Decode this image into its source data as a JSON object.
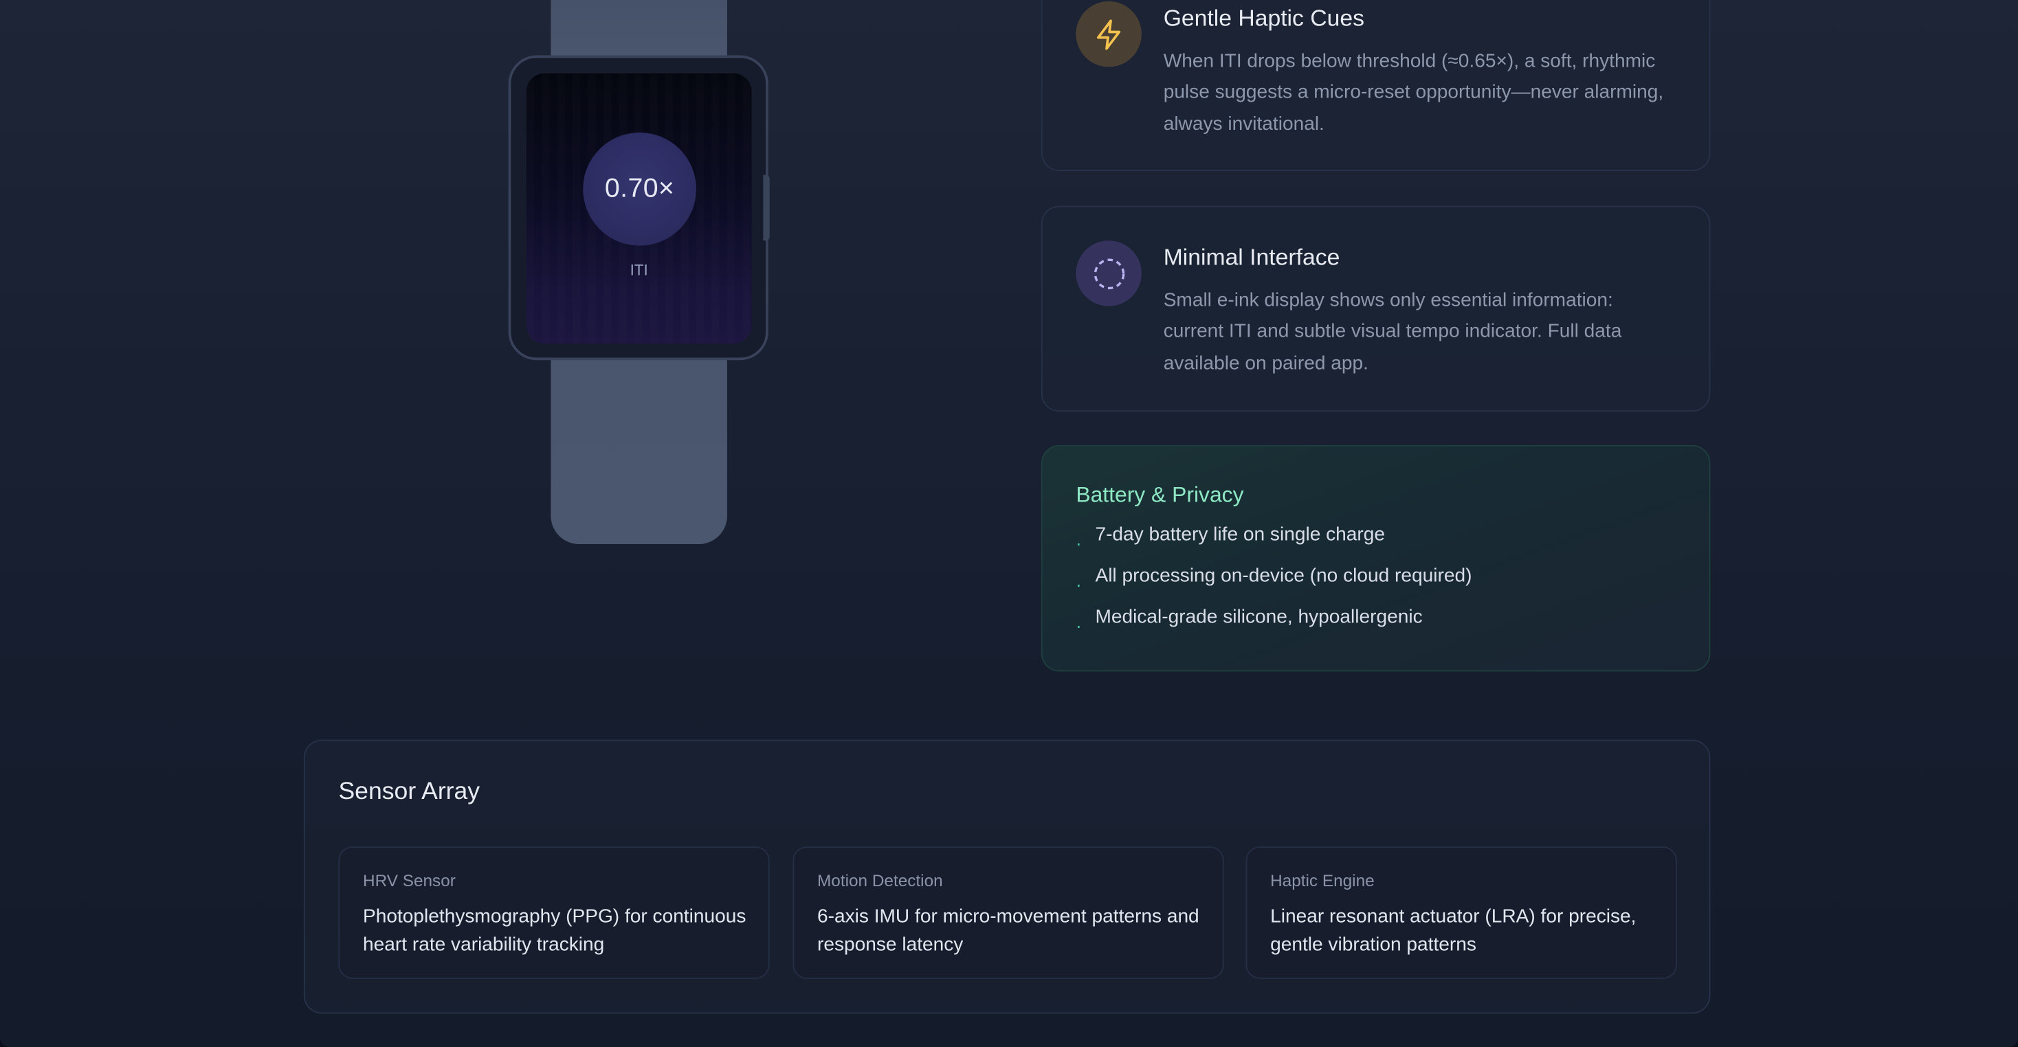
{
  "watch": {
    "iti_value": "0.70×",
    "iti_label": "ITI"
  },
  "features": [
    {
      "icon": "lightning-icon",
      "title": "Gentle Haptic Cues",
      "description": "When ITI drops below threshold (≈0.65×), a soft, rhythmic pulse suggests a micro-reset opportunity—never alarming, always invitational."
    },
    {
      "icon": "dashed-circle-icon",
      "title": "Minimal Interface",
      "description": "Small e-ink display shows only essential information: current ITI and subtle visual tempo indicator. Full data available on paired app."
    }
  ],
  "battery_privacy": {
    "title": "Battery & Privacy",
    "items": [
      "7-day battery life on single charge",
      "All processing on-device (no cloud required)",
      "Medical-grade silicone, hypoallergenic"
    ]
  },
  "sensor_array": {
    "title": "Sensor Array",
    "sensors": [
      {
        "label": "HRV Sensor",
        "description": "Photoplethysmography (PPG) for continuous heart rate variability tracking"
      },
      {
        "label": "Motion Detection",
        "description": "6-axis IMU for micro-movement patterns and response latency"
      },
      {
        "label": "Haptic Engine",
        "description": "Linear resonant actuator (LRA) for precise, gentle vibration patterns"
      }
    ]
  },
  "colors": {
    "accent_green": "#8ee8c4",
    "haptic_icon": "#f2c14e",
    "interface_icon": "#b9b3f0"
  }
}
